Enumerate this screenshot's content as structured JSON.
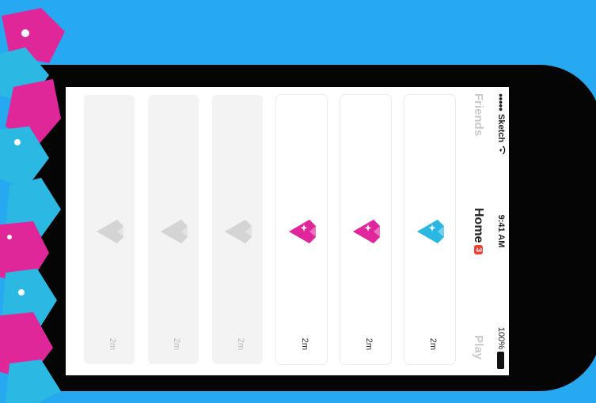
{
  "status_bar": {
    "carrier": "Sketch",
    "time": "9:41 AM",
    "battery": "100%"
  },
  "nav": {
    "left": "Friends",
    "center": "Home",
    "badge": "3",
    "right": "Play"
  },
  "cards": [
    {
      "time": "2m",
      "gem_color": "#2bb8e3",
      "active": true
    },
    {
      "time": "2m",
      "gem_color": "#e0279a",
      "active": true
    },
    {
      "time": "2m",
      "gem_color": "#e0279a",
      "active": true
    },
    {
      "time": "2m",
      "gem_color": "#d4d4d4",
      "active": false
    },
    {
      "time": "2m",
      "gem_color": "#d4d4d4",
      "active": false
    },
    {
      "time": "2m",
      "gem_color": "#d4d4d4",
      "active": false
    }
  ],
  "colors": {
    "background": "#27a9f2",
    "accent_pink": "#e0279a",
    "accent_blue": "#2bb8e3",
    "badge": "#f04030"
  }
}
